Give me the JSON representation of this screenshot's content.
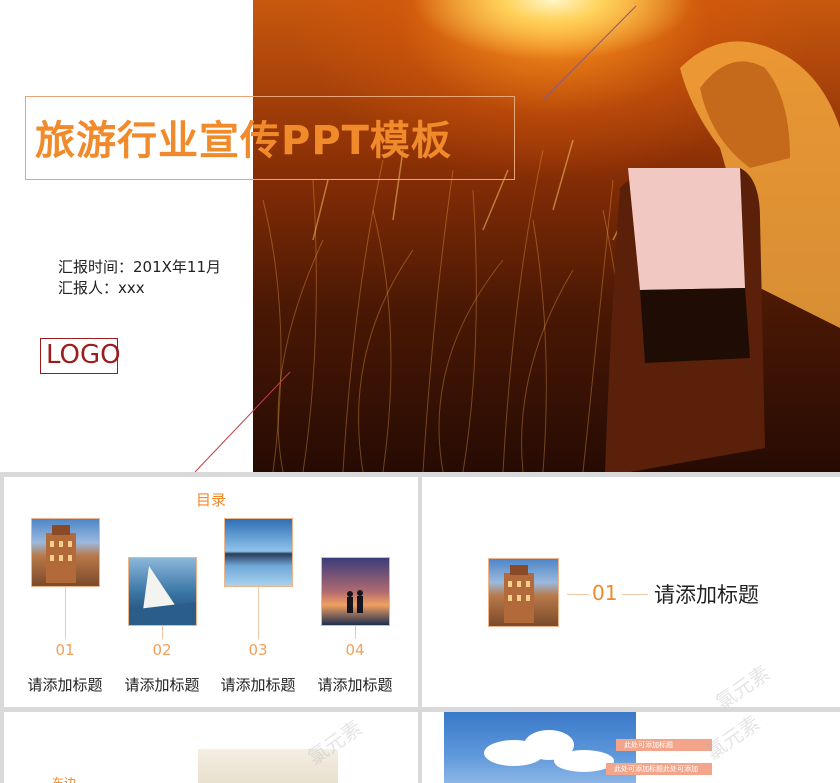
{
  "cover": {
    "title": "旅游行业宣传PPT模板",
    "report_time": "汇报时间：201X年11月",
    "reporter": "汇报人：xxx",
    "logo": "LOGO"
  },
  "toc": {
    "heading": "目录",
    "items": [
      {
        "num": "01",
        "label": "请添加标题",
        "photo": "building-photo"
      },
      {
        "num": "02",
        "label": "请添加标题",
        "photo": "sailboat-photo"
      },
      {
        "num": "03",
        "label": "请添加标题",
        "photo": "lake-photo"
      },
      {
        "num": "04",
        "label": "请添加标题",
        "photo": "couple-sunset-photo"
      }
    ]
  },
  "section": {
    "num": "01",
    "title": "请添加标题"
  },
  "bottom_left": {
    "text": "车边"
  },
  "bottom_right": {
    "bar1": "此处可添加标题",
    "bar2": "此处可添加标题此处可添加"
  },
  "colors": {
    "accent": "#f08a2a",
    "logo": "#9b1c1c",
    "line": "#f2c7a8"
  }
}
